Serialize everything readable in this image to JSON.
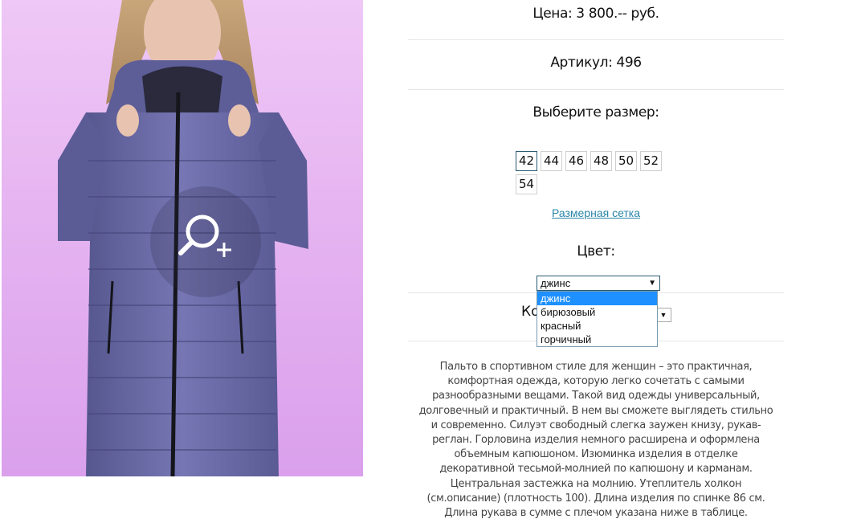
{
  "product": {
    "image_alt": "Пальто в спортивном стиле",
    "price": "Цена: 3 800.-- руб.",
    "sku": "Артикул: 496",
    "size_title": "Выберите размер:",
    "sizes": [
      "42",
      "44",
      "46",
      "48",
      "50",
      "52",
      "54"
    ],
    "selected_size": "42",
    "size_chart_link": "Размерная сетка",
    "color_title": "Цвет:",
    "color_selected": "джинс",
    "color_options": [
      "джинс",
      "бирюзовый",
      "красный",
      "горчичный"
    ],
    "quantity_label_partial": "Ко",
    "description": "Пальто в спортивном стиле для женщин – это практичная, комфортная одежда, которую легко сочетать с самыми разнообразными вещами. Такой вид одежды универсальный, долговечный и практичный. В нем вы сможете выглядеть стильно и современно. Силуэт свободный слегка заужен книзу, рукав-реглан. Горловина изделия немного расширена и оформлена объемным капюшоном. Изюминка изделия в отделке декоративной тесьмой-молнией по капюшону и карманам. Центральная застежка на молнию. Утеплитель холкон (см.описание) (плотность 100). Длина изделия по спинке 86 см. Длина рукава в сумме с плечом указана ниже в таблице."
  },
  "icons": {
    "zoom": "magnifier-plus-icon",
    "dropdown_arrow": "triangle-down-icon"
  },
  "colors": {
    "background_photo": "#e6b4f1",
    "coat": "#6a6aa8",
    "link": "#2a86a8",
    "dropdown_highlight": "#1e90ff",
    "active_size_border": "#2a5a73"
  }
}
